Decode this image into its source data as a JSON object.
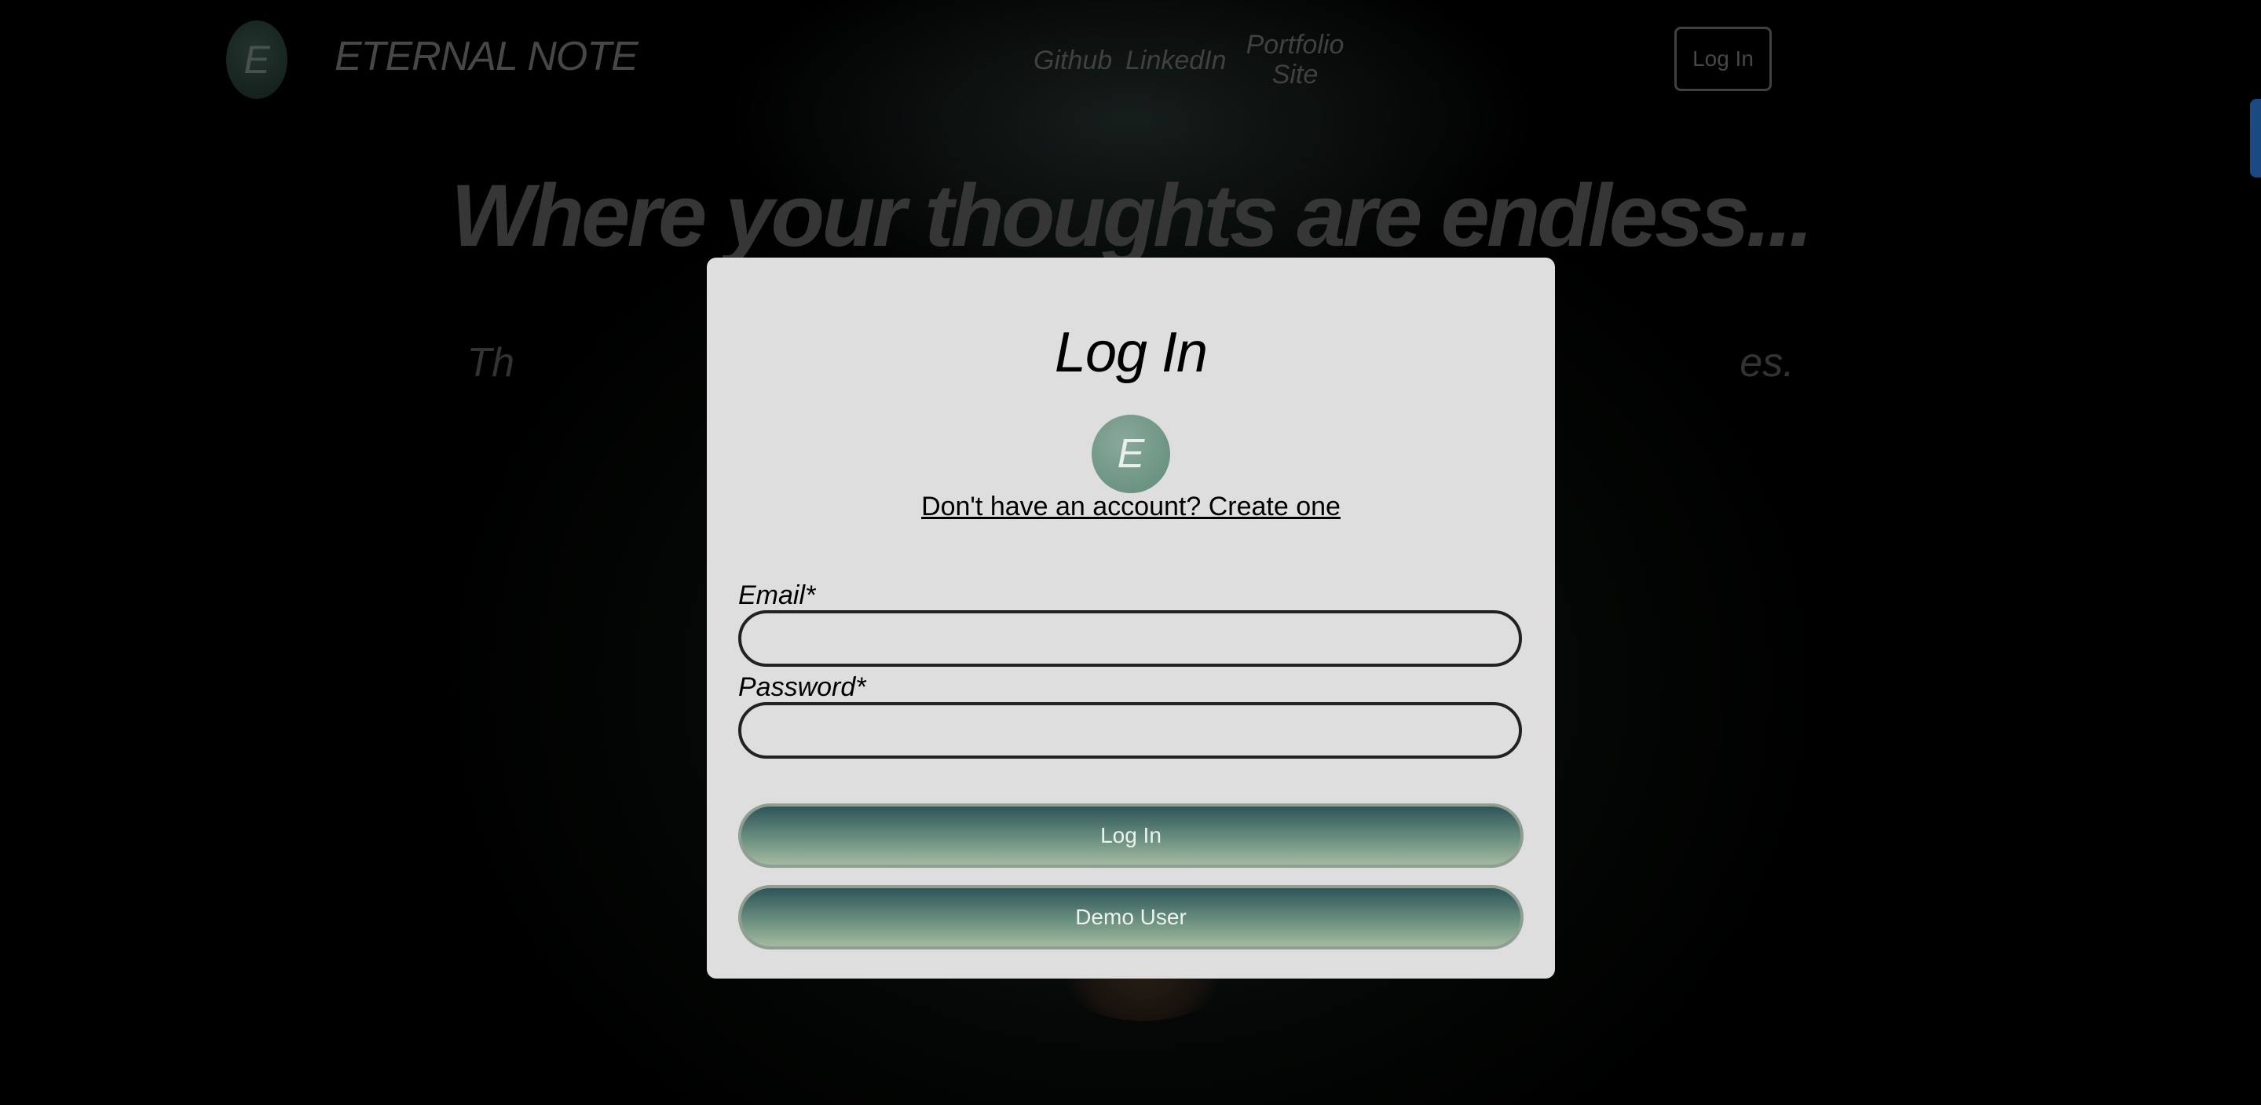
{
  "header": {
    "logo_letter": "E",
    "brand": "ETERNAL NOTE",
    "nav": {
      "github": "Github",
      "linkedin": "LinkedIn",
      "portfolio": "Portfolio Site"
    },
    "login_label": "Log In"
  },
  "hero": {
    "title": "Where your thoughts are endless...",
    "subtitle": "Th                                                                                                            es."
  },
  "modal": {
    "title": "Log In",
    "logo_letter": "E",
    "create_account_link": "Don't have an account? Create one",
    "email_label": "Email*",
    "email_value": "",
    "password_label": "Password*",
    "password_value": "",
    "login_button": "Log In",
    "demo_button": "Demo User"
  },
  "colors": {
    "button_gradient_top": "#2f5458",
    "button_gradient_bottom": "#a3b9a0",
    "modal_background": "#dedede",
    "side_tab": "#2f7fe0"
  }
}
